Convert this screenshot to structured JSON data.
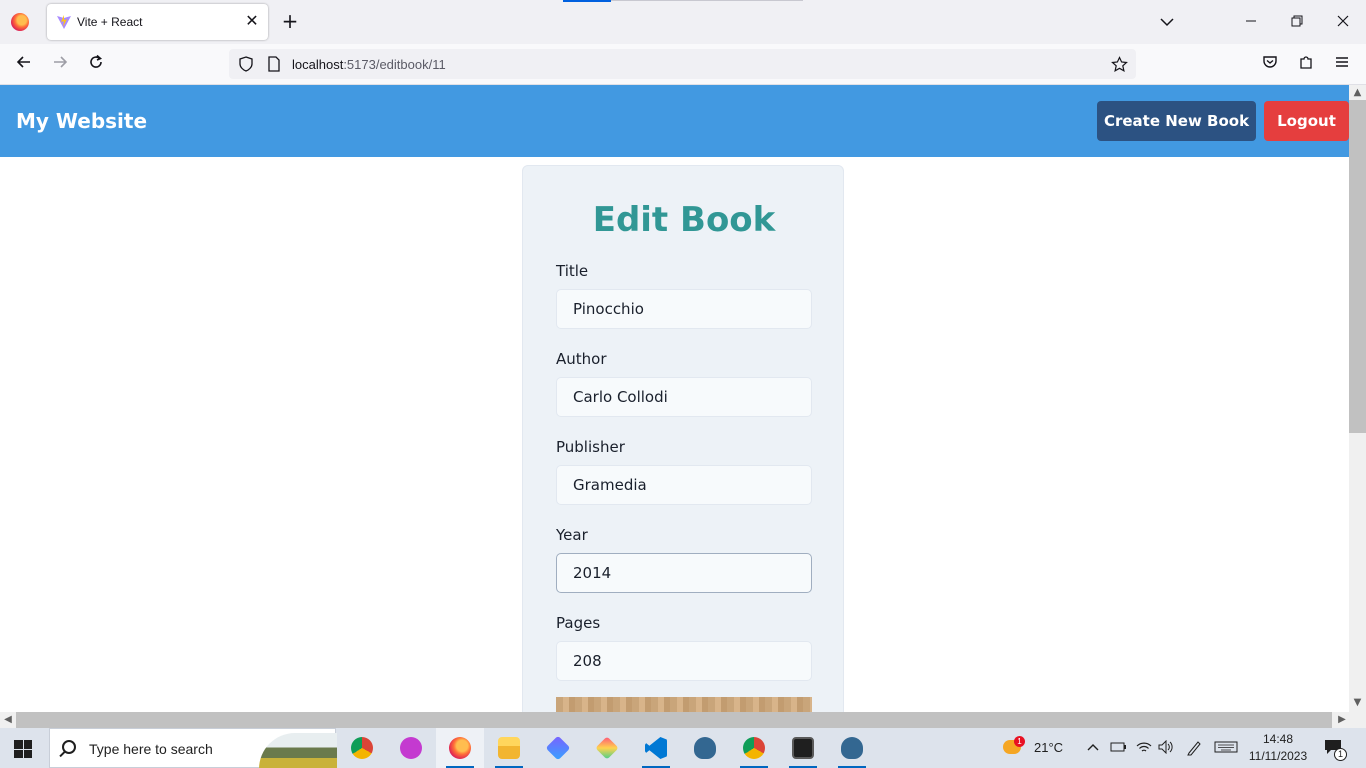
{
  "browser": {
    "tab_title": "Vite + React",
    "tab_close": "✕",
    "new_tab": "+",
    "url_host": "localhost",
    "url_path": ":5173/editbook/11"
  },
  "app": {
    "brand": "My Website",
    "create_button": "Create New Book",
    "logout_button": "Logout",
    "colors": {
      "header": "#4299e1",
      "create": "#2c5282",
      "logout": "#e53e3e",
      "title": "#319795"
    }
  },
  "form": {
    "title": "Edit Book",
    "fields": [
      {
        "label": "Title",
        "value": "Pinocchio"
      },
      {
        "label": "Author",
        "value": "Carlo Collodi"
      },
      {
        "label": "Publisher",
        "value": "Gramedia"
      },
      {
        "label": "Year",
        "value": "2014"
      },
      {
        "label": "Pages",
        "value": "208"
      }
    ]
  },
  "taskbar": {
    "search_placeholder": "Type here to search",
    "weather": "21°C",
    "weather_badge": "1",
    "time": "14:48",
    "date": "11/11/2023",
    "notification_count": "1"
  }
}
